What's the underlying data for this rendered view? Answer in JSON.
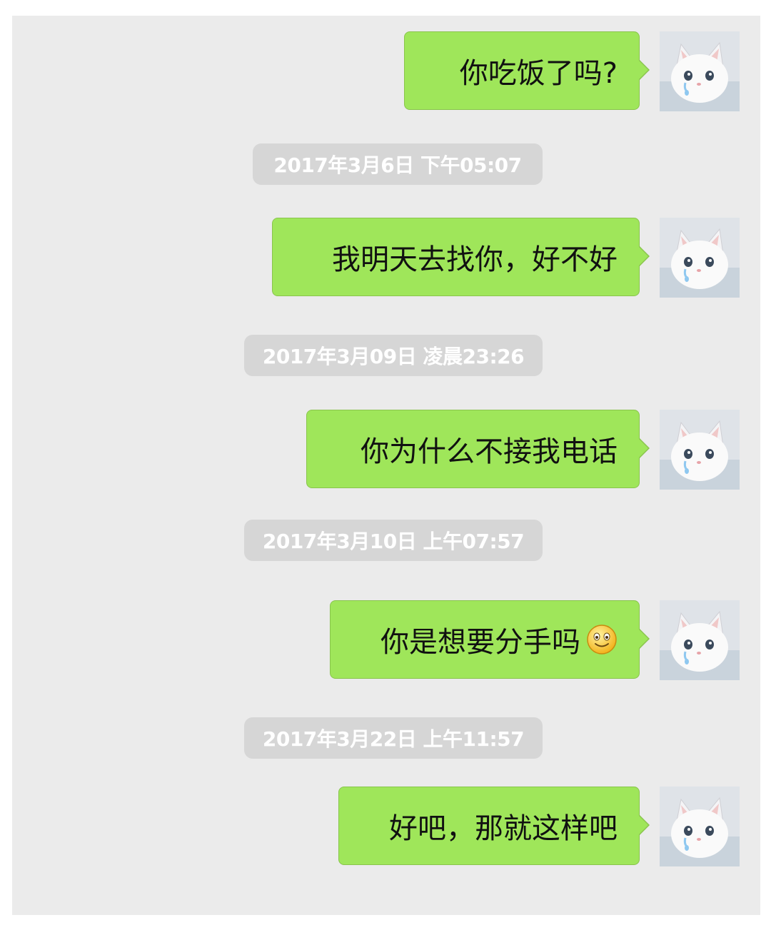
{
  "messages": [
    {
      "text": "你吃饭了吗?"
    },
    {
      "text": "我明天去找你，好不好"
    },
    {
      "text": "你为什么不接我电话"
    },
    {
      "text": "你是想要分手吗",
      "emoji": "smiling-face-icon"
    },
    {
      "text": "好吧，那就这样吧"
    }
  ],
  "timestamps": [
    "2017年3月6日   下午05:07",
    "2017年3月09日  凌晨23:26",
    "2017年3月10日  上午07:57",
    "2017年3月22日  上午11:57"
  ],
  "colors": {
    "chat_background": "#ebebeb",
    "bubble": "#9fe65a",
    "bubble_border": "#89c44d",
    "timestamp_bg": "#d6d6d6",
    "timestamp_text": "#ffffff"
  },
  "avatar": {
    "icon": "cat-avatar-icon"
  }
}
